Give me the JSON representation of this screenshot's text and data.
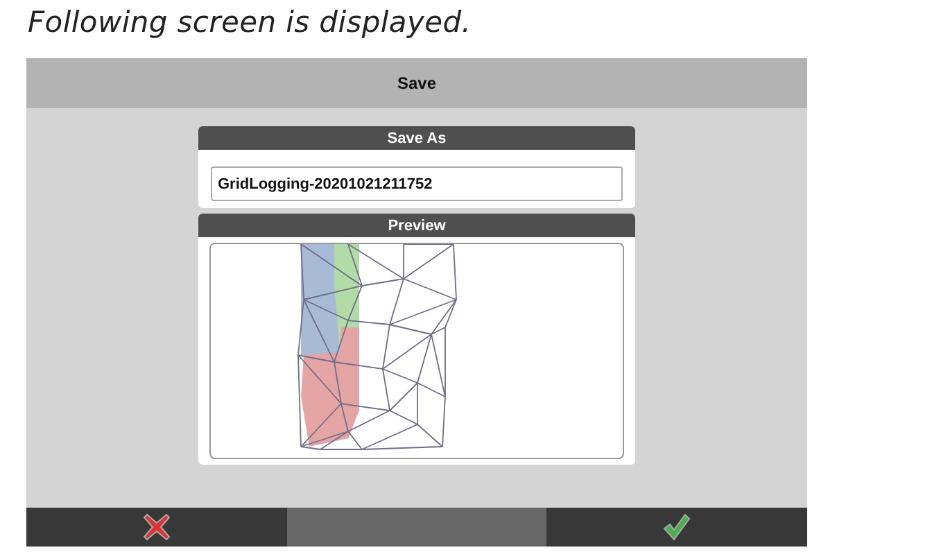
{
  "caption": "Following screen is displayed.",
  "window": {
    "title": "Save"
  },
  "save_as": {
    "header": "Save As",
    "value": "GridLogging-20201021211752"
  },
  "preview": {
    "header": "Preview"
  },
  "buttons": [
    {
      "kind": "cancel"
    },
    {
      "kind": "blank"
    },
    {
      "kind": "confirm"
    }
  ]
}
